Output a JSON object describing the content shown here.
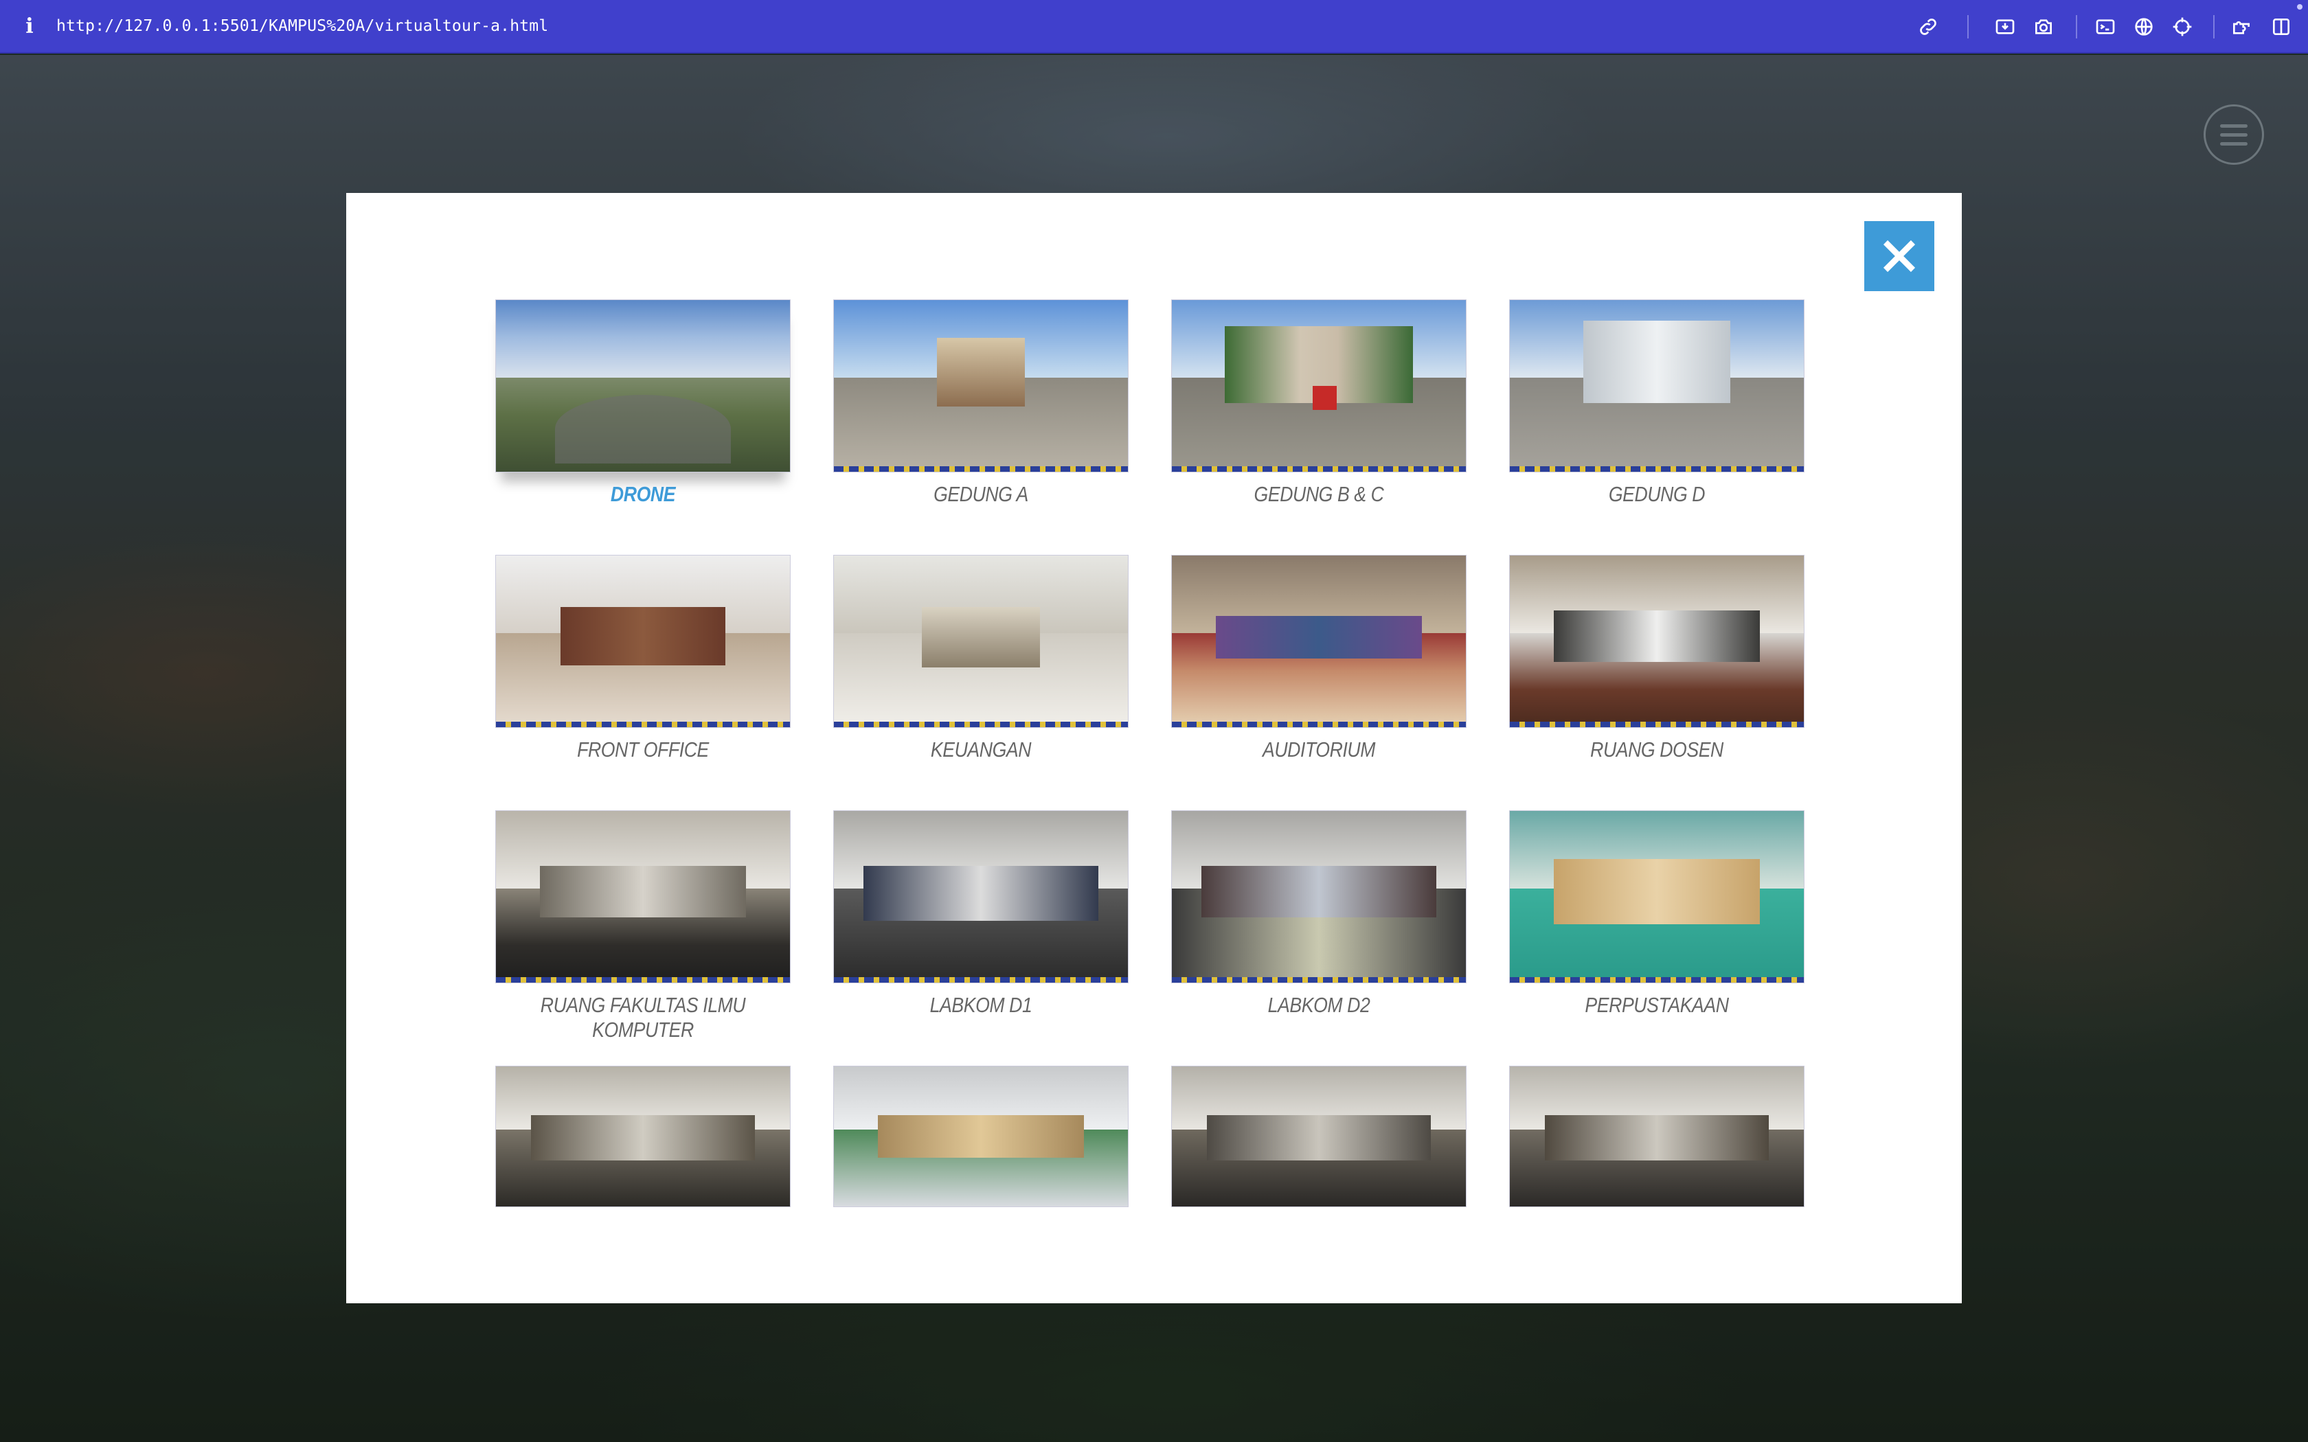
{
  "browser": {
    "url": "http://127.0.0.1:5501/KAMPUS%20A/virtualtour-a.html",
    "icons": [
      "link-icon",
      "install-icon",
      "camera-icon",
      "terminal-icon",
      "globe-icon",
      "crosshair-icon",
      "extensions-icon",
      "sidebar-icon"
    ]
  },
  "modal": {
    "close_icon": "close-icon",
    "accent": "#3e9bd8",
    "scenes": [
      {
        "label": "DRONE",
        "active": true
      },
      {
        "label": "GEDUNG A"
      },
      {
        "label": "GEDUNG B & C"
      },
      {
        "label": "GEDUNG D"
      },
      {
        "label": "FRONT OFFICE"
      },
      {
        "label": "KEUANGAN"
      },
      {
        "label": "AUDITORIUM"
      },
      {
        "label": "RUANG DOSEN"
      },
      {
        "label": "RUANG FAKULTAS ILMU KOMPUTER"
      },
      {
        "label": "LABKOM D1"
      },
      {
        "label": "LABKOM D2"
      },
      {
        "label": "PERPUSTAKAAN"
      },
      {
        "label": ""
      },
      {
        "label": ""
      },
      {
        "label": ""
      },
      {
        "label": ""
      }
    ]
  },
  "menu": {
    "icon": "hamburger-menu-icon"
  }
}
